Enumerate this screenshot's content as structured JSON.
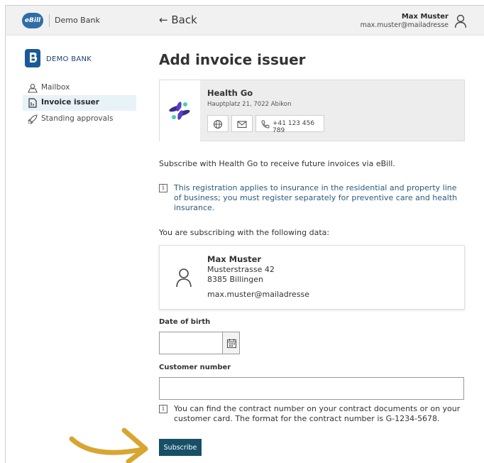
{
  "topbar": {
    "badge": "eBill",
    "bank_name": "Demo Bank",
    "back_label": "← Back",
    "user_name": "Max Muster",
    "user_email": "max.muster@mailadresse"
  },
  "sidebar": {
    "logo_text": "DEMO BANK",
    "items": [
      {
        "label": "Mailbox",
        "icon": "mailbox-icon"
      },
      {
        "label": "Invoice issuer",
        "icon": "document-icon",
        "active": true
      },
      {
        "label": "Standing approvals",
        "icon": "rocket-icon"
      }
    ]
  },
  "main": {
    "title": "Add invoice issuer",
    "issuer": {
      "name": "Health Go",
      "address": "Hauptplatz 21, 7022 Abikon",
      "phone": "+41 123 456 789"
    },
    "subscribe_text": "Subscribe with Health Go to receive future invoices via eBill.",
    "info_registration": "This registration applies to insurance in the residential and property line of business; you must register separately for preventive care and health insurance.",
    "following_text": "You are subscribing with the following data:",
    "subscriber": {
      "name": "Max Muster",
      "street": "Musterstrasse 42",
      "city": "8385 Billingen",
      "email": "max.muster@mailadresse"
    },
    "dob_label": "Date of birth",
    "dob_value": "",
    "customer_number_label": "Customer number",
    "customer_number_value": "",
    "info_contract": "You can find the contract number on your contract documents or on your customer card. The format for the contract number is G-1234-5678.",
    "subscribe_button": "Subscribe"
  },
  "colors": {
    "primary_button": "#174f67",
    "ebill_badge": "#2e6ea6",
    "info_text": "#2a5b7d",
    "arrow": "#d9a531",
    "active_nav": "#e8f2f9"
  }
}
